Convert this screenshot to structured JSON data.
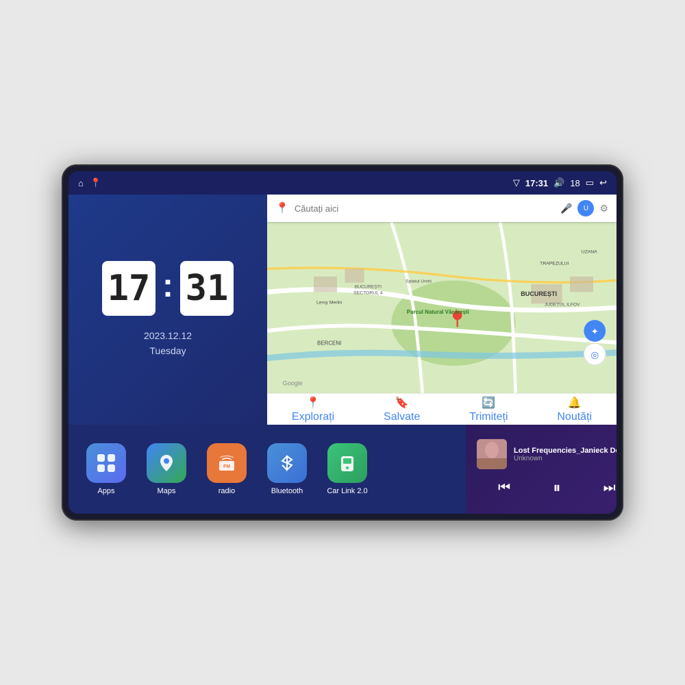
{
  "device": {
    "status_bar": {
      "left_icons": [
        "home",
        "map-pin"
      ],
      "time": "17:31",
      "signal_icon": "▽",
      "volume_icon": "🔊",
      "battery_level": "18",
      "battery_icon": "▭",
      "back_icon": "↩"
    },
    "clock": {
      "hours": "17",
      "minutes": "31"
    },
    "date": {
      "line1": "2023.12.12",
      "line2": "Tuesday"
    },
    "map": {
      "search_placeholder": "Căutați aici",
      "nav_items": [
        {
          "label": "Explorați",
          "icon": "📍",
          "active": true
        },
        {
          "label": "Salvate",
          "icon": "🔖",
          "active": false
        },
        {
          "label": "Trimiteți",
          "icon": "🔄",
          "active": false
        },
        {
          "label": "Noutăți",
          "icon": "🔔",
          "active": false
        }
      ],
      "location_labels": [
        "Parcul Natural Văcărești",
        "Leroy Merlin",
        "BUCUREȘTI",
        "JUDEȚUL ILFOV",
        "BERCENI",
        "Splaiul Unirii",
        "TRAPEZULUI",
        "UZANA",
        "BUCUREȘTI SECTORUL 4"
      ]
    },
    "apps": [
      {
        "id": "apps",
        "label": "Apps",
        "icon": "⊞",
        "color_class": "icon-apps"
      },
      {
        "id": "maps",
        "label": "Maps",
        "icon": "🗺",
        "color_class": "icon-maps"
      },
      {
        "id": "radio",
        "label": "radio",
        "icon": "📻",
        "color_class": "icon-radio"
      },
      {
        "id": "bluetooth",
        "label": "Bluetooth",
        "icon": "⚡",
        "color_class": "icon-bluetooth"
      },
      {
        "id": "carlink",
        "label": "Car Link 2.0",
        "icon": "📱",
        "color_class": "icon-carlink"
      }
    ],
    "music": {
      "title": "Lost Frequencies_Janieck Devy-...",
      "artist": "Unknown",
      "prev_label": "⏮",
      "play_label": "⏸",
      "next_label": "⏭"
    }
  }
}
